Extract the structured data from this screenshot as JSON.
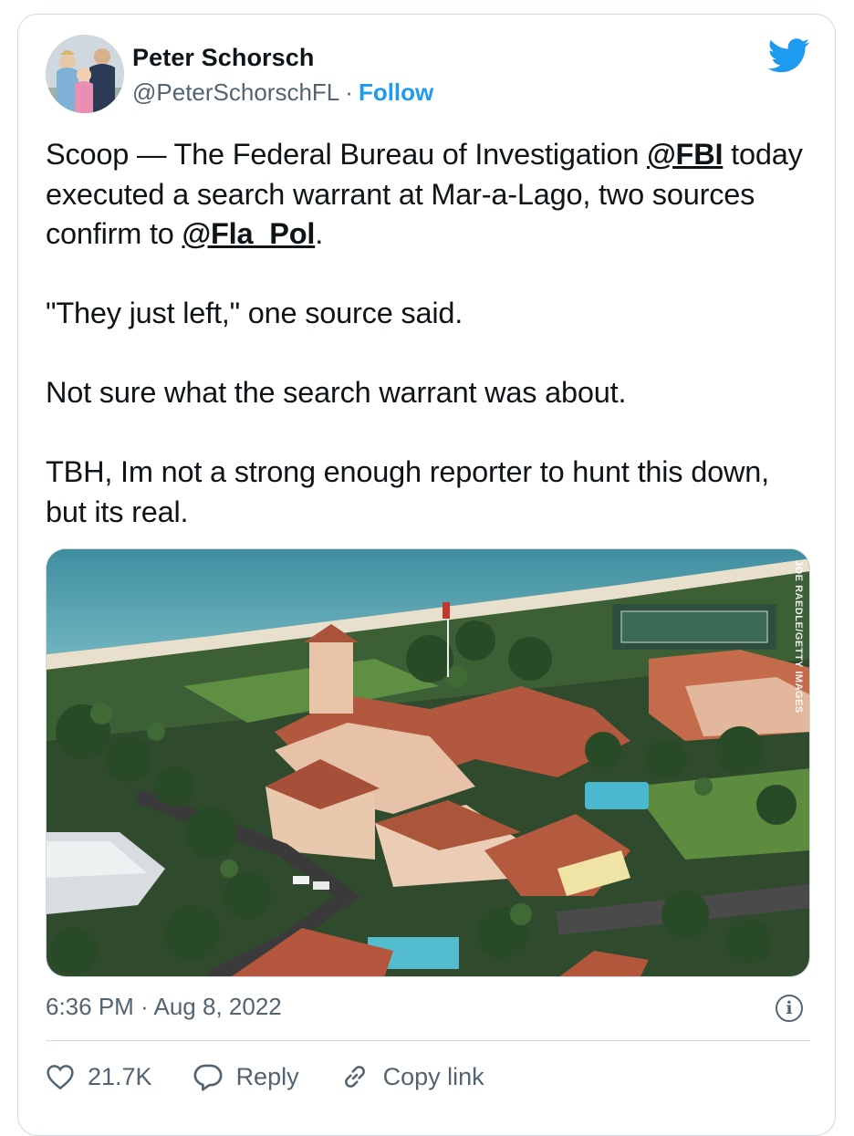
{
  "author": {
    "name": "Peter Schorsch",
    "handle": "@PeterSchorschFL",
    "separator": "·",
    "follow_label": "Follow"
  },
  "tweet": {
    "p1_a": "Scoop — The Federal Bureau of Investigation ",
    "p1_mention1": "@FBI",
    "p1_b": " today executed a search warrant at Mar-a-Lago, two sources confirm to ",
    "p1_mention2": "@Fla_Pol",
    "p1_c": ".",
    "p2": "\"They just left,\" one source said.",
    "p3": "Not sure what the search warrant was about.",
    "p4": "TBH, Im not a strong enough reporter to hunt this down, but its real."
  },
  "photo": {
    "credit": "JOE RAEDLE/GETTY IMAGES"
  },
  "meta": {
    "time": "6:36 PM",
    "separator": " · ",
    "date": "Aug 8, 2022"
  },
  "actions": {
    "likes": "21.7K",
    "reply": "Reply",
    "copy_link": "Copy link"
  },
  "colors": {
    "accent": "#1d9bf0",
    "text": "#0f1419",
    "secondary": "#536471",
    "border": "#cfd9de"
  },
  "icons": [
    "avatar",
    "twitter-bird-icon",
    "info-icon",
    "heart-icon",
    "reply-bubble-icon",
    "link-icon"
  ]
}
